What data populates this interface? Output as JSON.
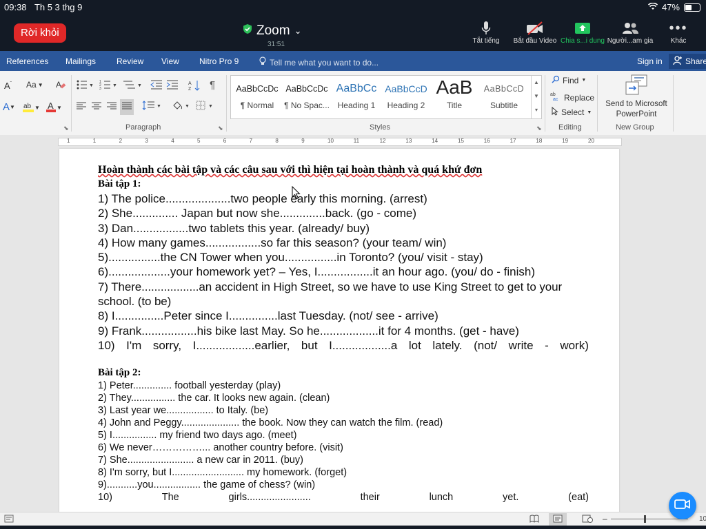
{
  "status_bar": {
    "time": "09:38",
    "date": "Th 5 3 thg 9",
    "battery": "47%",
    "battery_level": 0.47
  },
  "zoom": {
    "leave_label": "Rời khỏi",
    "title": "Zoom",
    "timer": "31:51",
    "buttons": [
      {
        "label": "Tắt tiếng",
        "icon": "microphone-icon"
      },
      {
        "label": "Bắt đầu Video",
        "icon": "video-off-icon"
      },
      {
        "label": "Chia s...i dung",
        "icon": "share-screen-icon"
      },
      {
        "label": "Người...am gia",
        "icon": "participants-icon"
      },
      {
        "label": "Khác",
        "icon": "more-icon"
      }
    ],
    "share_color": "#22c55e"
  },
  "word": {
    "tabs": [
      "References",
      "Mailings",
      "Review",
      "View",
      "Nitro Pro 9"
    ],
    "tell_me": "Tell me what you want to do...",
    "sign_in": "Sign in",
    "share": "Share",
    "ribbon": {
      "font_aa": "Aa",
      "paragraph_label": "Paragraph",
      "styles_label": "Styles",
      "editing_label": "Editing",
      "new_group_label": "New Group",
      "find": "Find",
      "replace": "Replace",
      "select": "Select",
      "send_to_ppt_line1": "Send to Microsoft",
      "send_to_ppt_line2": "PowerPoint",
      "styles": [
        {
          "preview": "AaBbCcDc",
          "name": "¶ Normal"
        },
        {
          "preview": "AaBbCcDc",
          "name": "¶ No Spac..."
        },
        {
          "preview": "AaBbCc",
          "name": "Heading 1"
        },
        {
          "preview": "AaBbCcD",
          "name": "Heading 2"
        },
        {
          "preview": "AaB",
          "name": "Title"
        },
        {
          "preview": "AaBbCcD",
          "name": "Subtitle"
        }
      ]
    },
    "ruler_numbers": [
      "1",
      "1",
      "2",
      "3",
      "4",
      "5",
      "6",
      "7",
      "8",
      "9",
      "10",
      "11",
      "12",
      "13",
      "14",
      "15",
      "16",
      "17",
      "18",
      "19",
      "20"
    ],
    "page_num_fragment": "10"
  },
  "document": {
    "heading": "Hoàn thành các bài tập và các câu sau với thì hiện tại hoàn thành và quá khứ đơn",
    "ex1_title": "Bài tập 1:",
    "ex1": [
      "1) The police....................two people early this morning. (arrest)",
      "2) She.............. Japan but now she..............back. (go - come)",
      "3) Dan.................two tablets this year. (already/ buy)",
      "4) How many games.................so far this season? (your team/ win)",
      "5)................the CN Tower when you................in Toronto? (you/ visit - stay)",
      "6)...................your homework yet? – Yes, I.................it an hour ago. (you/ do - finish)",
      "7) There..................an accident in High Street, so we have to use King Street to get to your school. (to be)",
      "8) I...............Peter since I...............last Tuesday. (not/ see - arrive)",
      "9) Frank.................his bike last May. So he..................it for 4 months. (get - have)"
    ],
    "ex1_line10": [
      "10)",
      "I'm",
      "sorry,",
      "I..................earlier,",
      "but",
      "I..................a",
      "lot",
      "lately.",
      "(not/",
      "write",
      "-",
      "work)"
    ],
    "ex2_title": "Bài tập 2:",
    "ex2": [
      "1) Peter.............. football yesterday (play)",
      "2) They................ the car. It looks new again. (clean)",
      "3) Last year we................. to Italy. (be)",
      "4) John and Peggy..................... the book. Now they can watch the film. (read)",
      "5) I................ my friend two days ago. (meet)",
      "6) We never……………... another country before. (visit)",
      "7) She........................ a new car in 2011. (buy)",
      "8) I'm sorry, but I.......................... my homework. (forget)",
      "9)...........you................. the game of chess? (win)"
    ],
    "ex2_line10": [
      "10)",
      "The",
      "girls.......................",
      "their",
      "lunch",
      "yet.",
      "(eat)"
    ]
  }
}
